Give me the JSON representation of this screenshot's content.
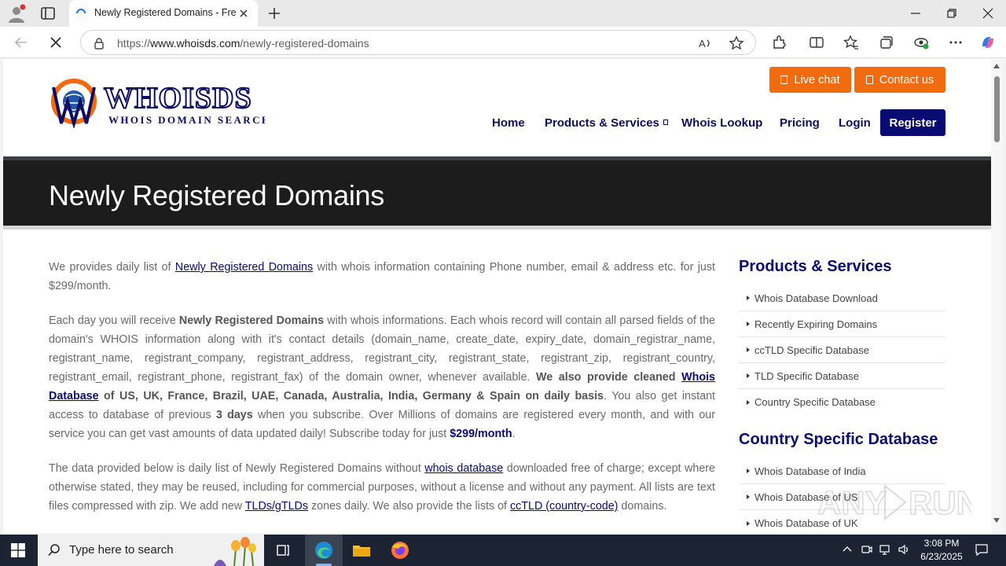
{
  "browser": {
    "tab_title": "Newly Registered Domains - Free",
    "url_prefix": "https://",
    "url_domain": "www.whoisds.com",
    "url_path": "/newly-registered-domains"
  },
  "header": {
    "logo_text": "WHOISDS",
    "logo_tagline": "Whois Domain Search",
    "live_chat": "Live chat",
    "contact_us": "Contact us",
    "nav": {
      "home": "Home",
      "products": "Products & Services",
      "whois_lookup": "Whois Lookup",
      "pricing": "Pricing",
      "login": "Login",
      "register": "Register"
    }
  },
  "hero": {
    "title": "Newly Registered Domains"
  },
  "article": {
    "p1": {
      "a": "We provides daily list of ",
      "link": "Newly Registered Domains",
      "b": " with whois information containing Phone number, email & address etc. for just $299/month."
    },
    "p2": {
      "a": "Each day you will receive ",
      "strong1": "Newly Registered Domains",
      "b": " with whois informations. Each whois record will contain all parsed fields of the domain's WHOIS information along with it's contact details (domain_name, create_date, expiry_date, domain_registrar_name, registrant_name, registrant_company, registrant_address, registrant_city, registrant_state, registrant_zip, registrant_country, registrant_email, registrant_phone, registrant_fax) of the domain owner, whenever available. ",
      "strong2": "We also provide cleaned ",
      "link": "Whois Database",
      "strong3": " of US, UK, France, Brazil, UAE, Canada, Australia, India, Germany & Spain on daily basis",
      "c": ". You also get instant access to database of previous ",
      "strong4": "3 days",
      "d": " when you subscribe. Over Millions of domains are registered every month, and with our service you can get vast amounts of data updated daily! Subscribe today for just ",
      "price": "$299/month",
      "e": "."
    },
    "p3": {
      "a": "The data provided below is daily list of Newly Registered Domains without ",
      "link1": "whois database",
      "b": " downloaded free of charge; except where otherwise stated, they may be reused, including for commercial purposes, without a license and without any payment. All lists are text files compressed with zip. We add new ",
      "link2": "TLDs/gTLDs",
      "c": " zones daily. We also provide the lists of ",
      "link3": "ccTLD (country-code)",
      "d": " domains."
    }
  },
  "sidebar": {
    "products_title": "Products & Services",
    "products": [
      "Whois Database Download",
      "Recently Expiring Domains",
      "ccTLD Specific Database",
      "TLD Specific Database",
      "Country Specific Database"
    ],
    "country_title": "Country Specific Database",
    "countries": [
      "Whois Database of India",
      "Whois Database of US",
      "Whois Database of UK"
    ]
  },
  "taskbar": {
    "search_placeholder": "Type here to search",
    "time": "3:08 PM",
    "date": "6/23/2025"
  },
  "colors": {
    "brand_navy": "#0a0a73",
    "accent_orange": "#f26b0f",
    "hero_bg": "#1c1c1c"
  }
}
